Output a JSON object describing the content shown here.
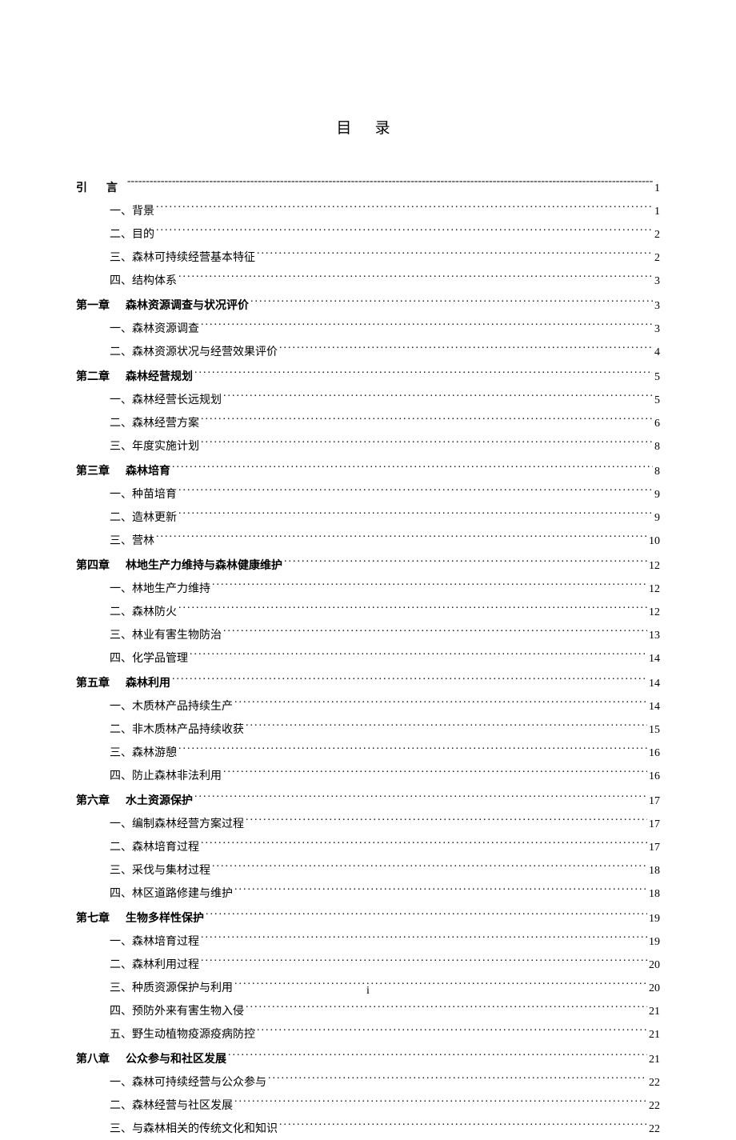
{
  "title": "目 录",
  "page_number": "i",
  "entries": [
    {
      "level": "intro",
      "text": "引 言",
      "leader": "dash",
      "page": "1"
    },
    {
      "level": "sub",
      "text": "一、背景",
      "leader": "dot",
      "page": "1"
    },
    {
      "level": "sub",
      "text": "二、目的",
      "leader": "dot",
      "page": "2"
    },
    {
      "level": "sub",
      "text": "三、森林可持续经营基本特征",
      "leader": "dot",
      "page": "2"
    },
    {
      "level": "sub",
      "text": "四、结构体系",
      "leader": "dot",
      "page": "3"
    },
    {
      "level": "chapter",
      "num": "第一章",
      "title": "森林资源调查与状况评价",
      "leader": "dot",
      "page": "3"
    },
    {
      "level": "sub",
      "text": "一、森林资源调查",
      "leader": "dot",
      "page": "3"
    },
    {
      "level": "sub",
      "text": "二、森林资源状况与经营效果评价",
      "leader": "dot",
      "page": "4"
    },
    {
      "level": "chapter",
      "num": "第二章",
      "title": "森林经营规划",
      "leader": "dot",
      "page": "5"
    },
    {
      "level": "sub",
      "text": "一、森林经营长远规划",
      "leader": "dot",
      "page": "5"
    },
    {
      "level": "sub",
      "text": "二、森林经营方案",
      "leader": "dot",
      "page": "6"
    },
    {
      "level": "sub",
      "text": "三、年度实施计划",
      "leader": "dot",
      "page": "8"
    },
    {
      "level": "chapter",
      "num": "第三章",
      "title": "森林培育",
      "leader": "dot",
      "page": "8"
    },
    {
      "level": "sub",
      "text": "一、种苗培育",
      "leader": "dot",
      "page": "9"
    },
    {
      "level": "sub",
      "text": "二、造林更新",
      "leader": "dot",
      "page": "9"
    },
    {
      "level": "sub",
      "text": "三、营林",
      "leader": "dot",
      "page": "10"
    },
    {
      "level": "chapter",
      "num": "第四章",
      "title": "林地生产力维持与森林健康维护",
      "leader": "dot",
      "page": "12"
    },
    {
      "level": "sub",
      "text": "一、林地生产力维持",
      "leader": "dot",
      "page": "12"
    },
    {
      "level": "sub",
      "text": "二、森林防火",
      "leader": "dot",
      "page": "12"
    },
    {
      "level": "sub",
      "text": "三、林业有害生物防治",
      "leader": "dot",
      "page": "13"
    },
    {
      "level": "sub",
      "text": "四、化学品管理",
      "leader": "dot",
      "page": "14"
    },
    {
      "level": "chapter",
      "num": "第五章",
      "title": "森林利用",
      "leader": "dot",
      "page": "14"
    },
    {
      "level": "sub",
      "text": "一、木质林产品持续生产",
      "leader": "dot",
      "page": "14"
    },
    {
      "level": "sub",
      "text": "二、非木质林产品持续收获",
      "leader": "dot",
      "page": "15"
    },
    {
      "level": "sub",
      "text": "三、森林游憩",
      "leader": "dot",
      "page": "16"
    },
    {
      "level": "sub",
      "text": "四、防止森林非法利用",
      "leader": "dot",
      "page": "16"
    },
    {
      "level": "chapter",
      "num": "第六章",
      "title": "水土资源保护",
      "leader": "dot",
      "page": "17"
    },
    {
      "level": "sub",
      "text": "一、编制森林经营方案过程",
      "leader": "dot",
      "page": "17"
    },
    {
      "level": "sub",
      "text": "二、森林培育过程",
      "leader": "dot",
      "page": "17"
    },
    {
      "level": "sub",
      "text": "三、采伐与集材过程",
      "leader": "dot",
      "page": "18"
    },
    {
      "level": "sub",
      "text": "四、林区道路修建与维护",
      "leader": "dot",
      "page": "18"
    },
    {
      "level": "chapter",
      "num": "第七章",
      "title": "生物多样性保护",
      "leader": "dot",
      "page": "19"
    },
    {
      "level": "sub",
      "text": "一、森林培育过程",
      "leader": "dot",
      "page": "19"
    },
    {
      "level": "sub",
      "text": "二、森林利用过程",
      "leader": "dot",
      "page": "20"
    },
    {
      "level": "sub",
      "text": "三、种质资源保护与利用",
      "leader": "dot",
      "page": "20"
    },
    {
      "level": "sub",
      "text": "四、预防外来有害生物入侵",
      "leader": "dot",
      "page": "21"
    },
    {
      "level": "sub",
      "text": "五、野生动植物疫源疫病防控",
      "leader": "dot",
      "page": "21"
    },
    {
      "level": "chapter",
      "num": "第八章",
      "title": "公众参与和社区发展",
      "leader": "dot",
      "page": "21"
    },
    {
      "level": "sub",
      "text": "一、森林可持续经营与公众参与",
      "leader": "dot",
      "page": "22"
    },
    {
      "level": "sub",
      "text": "二、森林经营与社区发展",
      "leader": "dot",
      "page": "22"
    },
    {
      "level": "sub",
      "text": "三、与森林相关的传统文化和知识",
      "leader": "dot",
      "page": "22"
    }
  ]
}
